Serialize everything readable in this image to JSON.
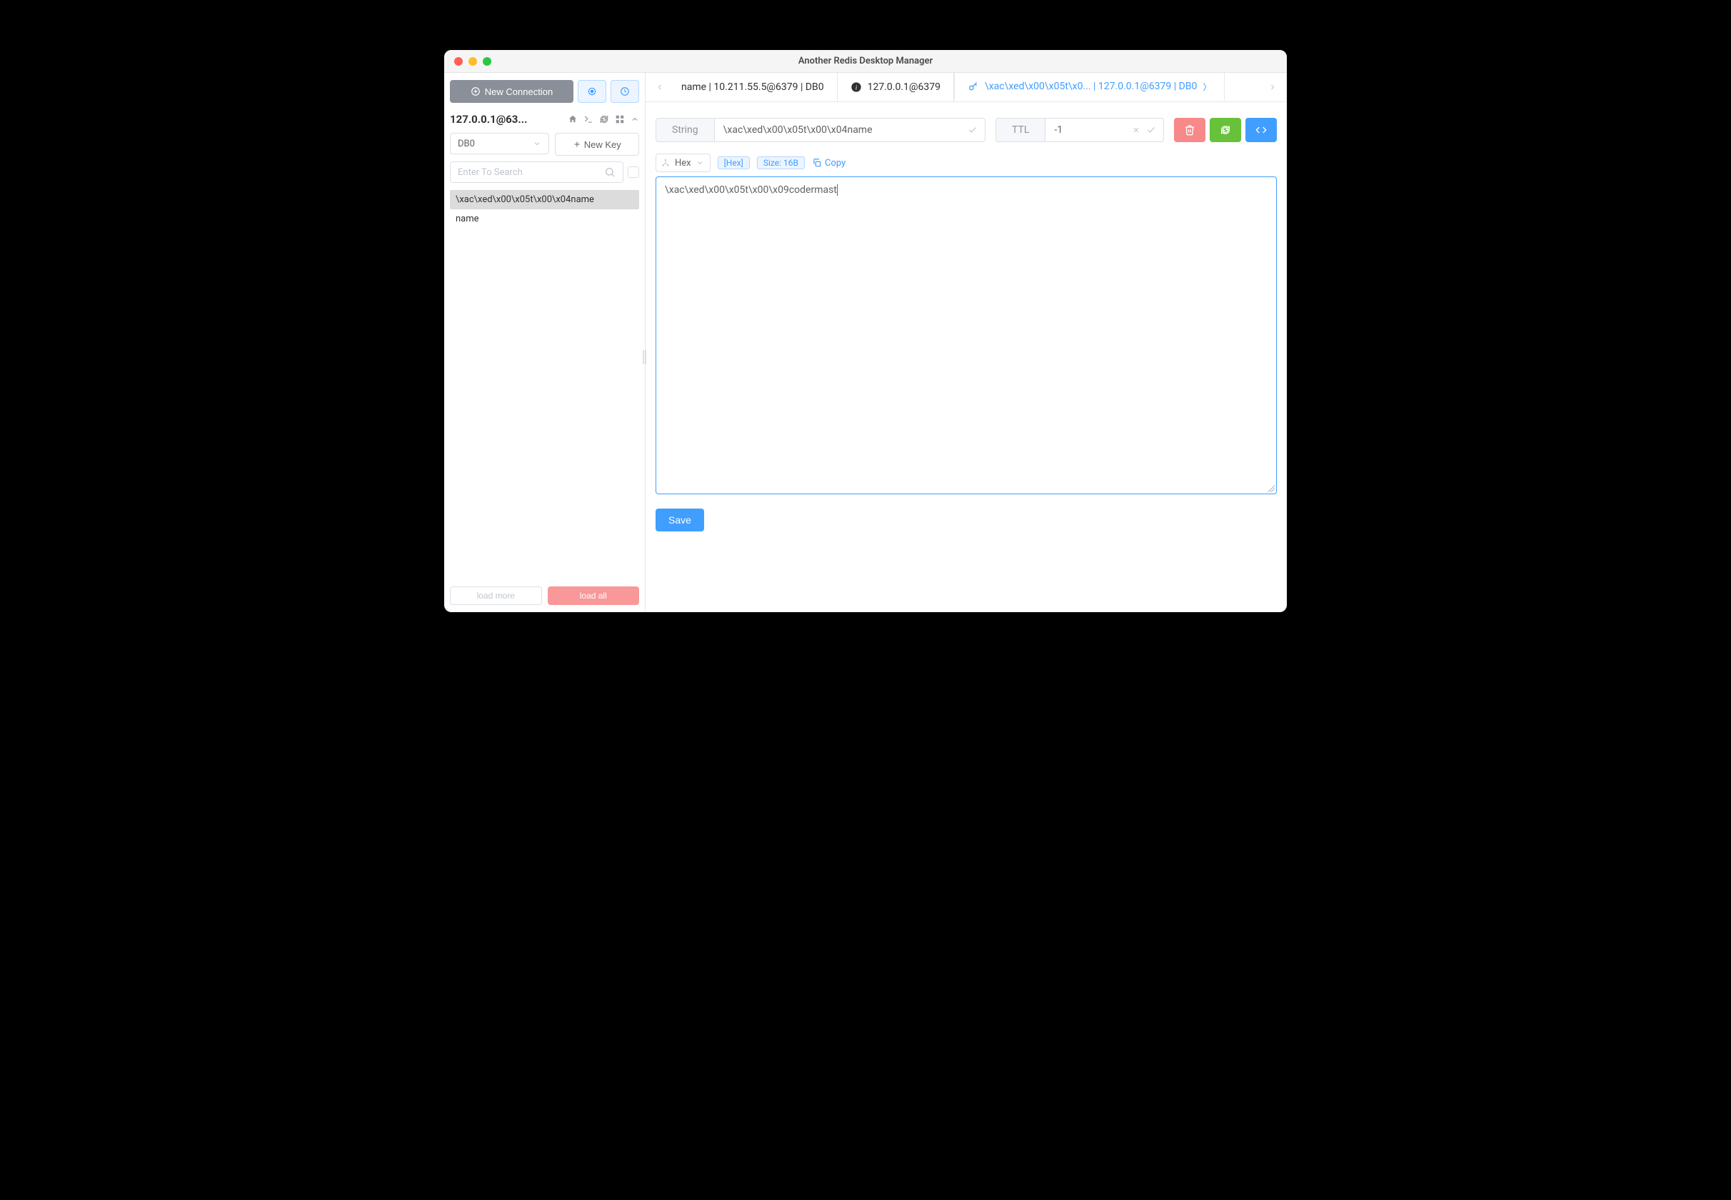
{
  "window": {
    "title": "Another Redis Desktop Manager"
  },
  "sidebar": {
    "new_connection_label": "New Connection",
    "connection_name": "127.0.0.1@63...",
    "db_selector": "DB0",
    "new_key_label": "New Key",
    "search_placeholder": "Enter To Search",
    "keys": [
      {
        "label": "\\xac\\xed\\x00\\x05t\\x00\\x04name"
      },
      {
        "label": "name"
      }
    ],
    "load_more_label": "load more",
    "load_all_label": "load all"
  },
  "tabs": {
    "items": [
      {
        "label": "name | 10.211.55.5@6379 | DB0"
      },
      {
        "label": "127.0.0.1@6379"
      },
      {
        "label": "\\xac\\xed\\x00\\x05t\\x0... | 127.0.0.1@6379 | DB0"
      }
    ]
  },
  "key_detail": {
    "type_label": "String",
    "key_value": "\\xac\\xed\\x00\\x05t\\x00\\x04name",
    "ttl_label": "TTL",
    "ttl_value": "-1",
    "format_selector": "Hex",
    "hex_tag": "[Hex]",
    "size_tag": "Size: 16B",
    "copy_label": "Copy",
    "value_content": "\\xac\\xed\\x00\\x05t\\x00\\x09codermast",
    "save_label": "Save"
  }
}
